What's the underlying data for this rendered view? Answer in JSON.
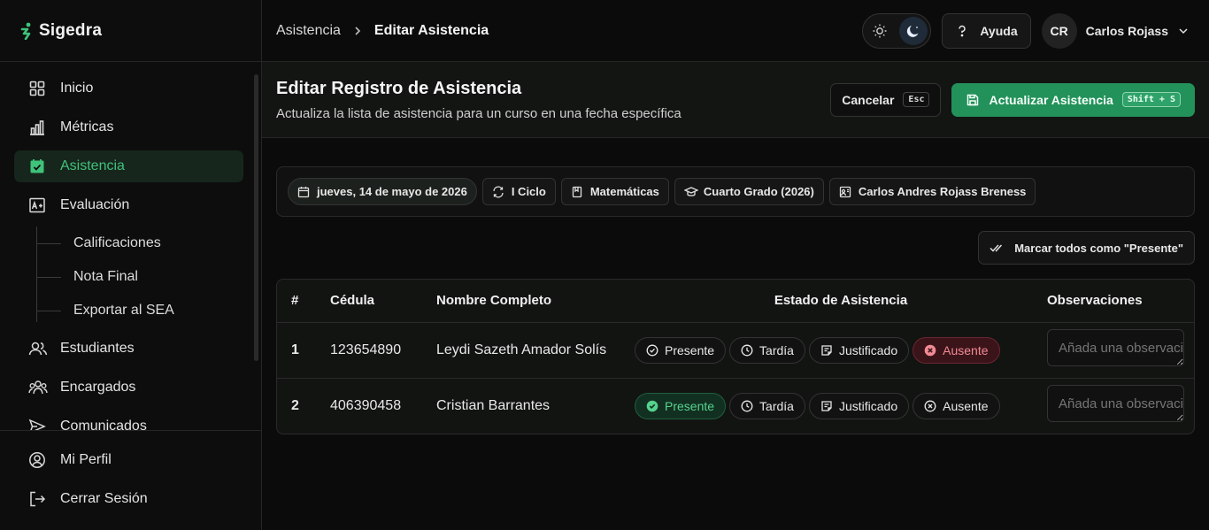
{
  "app": {
    "name": "Sigedra"
  },
  "sidebar": {
    "items": [
      {
        "label": "Inicio",
        "icon": "grid-icon"
      },
      {
        "label": "Métricas",
        "icon": "bar-chart-icon"
      },
      {
        "label": "Asistencia",
        "icon": "calendar-check-icon",
        "active": true
      },
      {
        "label": "Evaluación",
        "icon": "grade-icon"
      }
    ],
    "sub_items": [
      "Calificaciones",
      "Nota Final",
      "Exportar al SEA"
    ],
    "items_after": [
      {
        "label": "Estudiantes",
        "icon": "users-icon"
      },
      {
        "label": "Encargados",
        "icon": "guardians-icon"
      },
      {
        "label": "Comunicados",
        "icon": "send-icon"
      }
    ],
    "bottom": [
      {
        "label": "Mi Perfil",
        "icon": "user-circle-icon"
      },
      {
        "label": "Cerrar Sesión",
        "icon": "logout-icon"
      }
    ]
  },
  "topbar": {
    "breadcrumb": {
      "parent": "Asistencia",
      "current": "Editar Asistencia"
    },
    "help_label": "Ayuda",
    "user": {
      "initials": "CR",
      "name": "Carlos Rojass"
    },
    "theme": "dark"
  },
  "header": {
    "title": "Editar Registro de Asistencia",
    "subtitle": "Actualiza la lista de asistencia para un curso en una fecha específica",
    "cancel_label": "Cancelar",
    "cancel_shortcut": "Esc",
    "update_label": "Actualizar Asistencia",
    "update_shortcut": "Shift + S"
  },
  "filters": {
    "date": "jueves, 14 de mayo de 2026",
    "period": "I Ciclo",
    "subject": "Matemáticas",
    "grade": "Cuarto Grado (2026)",
    "teacher": "Carlos Andres Rojass Breness"
  },
  "mark_all_label": "Marcar todos como \"Presente\"",
  "table": {
    "headers": {
      "num": "#",
      "cedula": "Cédula",
      "name": "Nombre Completo",
      "status": "Estado de Asistencia",
      "obs": "Observaciones"
    },
    "status_options": {
      "present": "Presente",
      "late": "Tardía",
      "justified": "Justificado",
      "absent": "Ausente"
    },
    "obs_placeholder": "Añada una observación",
    "rows": [
      {
        "num": "1",
        "cedula": "123654890",
        "name": "Leydi Sazeth Amador Solís",
        "status": "absent"
      },
      {
        "num": "2",
        "cedula": "406390458",
        "name": "Cristian Barrantes",
        "status": "present"
      }
    ]
  },
  "colors": {
    "accent": "#22915a",
    "accent_text": "#3fc27a",
    "absent": "#f28a94"
  }
}
